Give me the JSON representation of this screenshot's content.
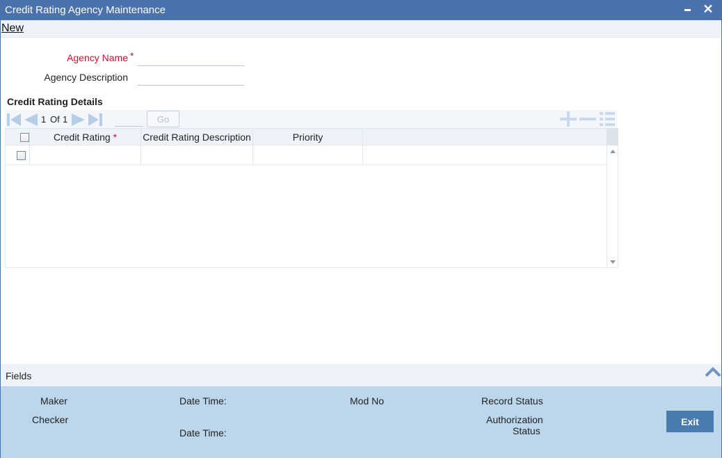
{
  "window": {
    "title": "Credit Rating Agency Maintenance",
    "minimize_icon": "minimize-icon",
    "close_icon": "close-icon",
    "close_glyph": "✕"
  },
  "menu": {
    "new_label": "New"
  },
  "form": {
    "agency_name_label": "Agency Name",
    "agency_name_value": "",
    "agency_description_label": "Agency Description",
    "agency_description_value": "",
    "required_marker": "*"
  },
  "section": {
    "title": "Credit Rating Details"
  },
  "pager": {
    "current": "1",
    "of_label": "Of",
    "total": "1",
    "page_input_value": "",
    "go_label": "Go"
  },
  "grid": {
    "columns": [
      {
        "label": "Credit Rating",
        "required": true
      },
      {
        "label": "Credit Rating Description",
        "required": false
      },
      {
        "label": "Priority",
        "required": false
      }
    ],
    "rows": [
      {
        "credit_rating": "",
        "description": "",
        "priority": ""
      }
    ]
  },
  "fields_bar": {
    "label": "Fields"
  },
  "footer": {
    "maker_label": "Maker",
    "checker_label": "Checker",
    "date_time_label": "Date Time:",
    "date_time_label_2": "Date Time:",
    "mod_no_label": "Mod No",
    "record_status_label": "Record Status",
    "authorization_label": "Authorization",
    "status_label": "Status",
    "exit_label": "Exit"
  },
  "colors": {
    "titlebar": "#4a72ad",
    "required": "#c8102e",
    "footer_bg": "#bcd7ec",
    "exit_button": "#4a7bb0"
  }
}
